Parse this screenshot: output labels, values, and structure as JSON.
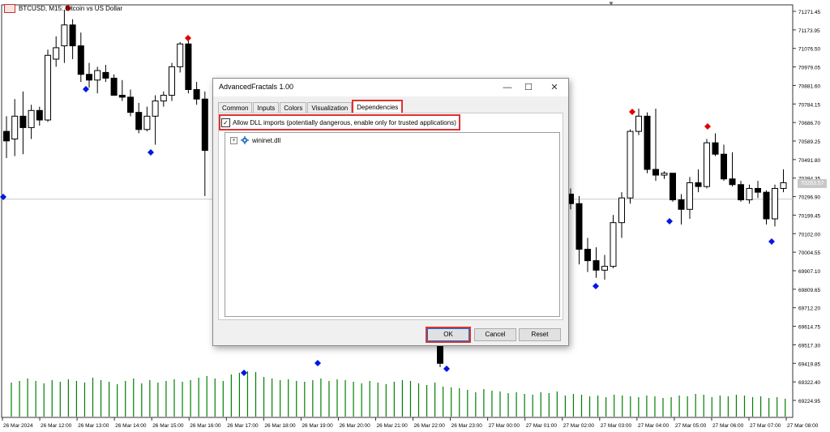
{
  "chart": {
    "title": "BTCUSD, M15: Bitcoin vs US Dollar",
    "current_price": "70283.57",
    "price_levels": [
      "71271.45",
      "71173.95",
      "71076.50",
      "70979.05",
      "70881.60",
      "70784.15",
      "70686.70",
      "70589.25",
      "70491.80",
      "70394.35",
      "70296.90",
      "70199.45",
      "70102.00",
      "70004.55",
      "69907.10",
      "69809.65",
      "69712.20",
      "69614.75",
      "69517.30",
      "69419.85",
      "69322.40",
      "69224.95"
    ],
    "time_labels": [
      "26 Mar 2024",
      "26 Mar 12:00",
      "26 Mar 13:00",
      "26 Mar 14:00",
      "26 Mar 15:00",
      "26 Mar 16:00",
      "26 Mar 17:00",
      "26 Mar 18:00",
      "26 Mar 19:00",
      "26 Mar 20:00",
      "26 Mar 21:00",
      "26 Mar 22:00",
      "26 Mar 23:00",
      "27 Mar 00:00",
      "27 Mar 01:00",
      "27 Mar 02:00",
      "27 Mar 03:00",
      "27 Mar 04:00",
      "27 Mar 05:00",
      "27 Mar 06:00",
      "27 Mar 07:00",
      "27 Mar 08:00"
    ],
    "colors": {
      "bull_candle": "#ffffff",
      "bear_candle": "#000000",
      "volume": "#008000",
      "fractal_up": "#e00000",
      "fractal_down": "#0018e0",
      "grid": "#c8c8c8"
    },
    "candles_left": [
      [
        70640,
        70720,
        70500,
        70590
      ],
      [
        70600,
        70810,
        70510,
        70720
      ],
      [
        70720,
        70850,
        70520,
        70660
      ],
      [
        70660,
        70780,
        70600,
        70750
      ],
      [
        70750,
        70770,
        70670,
        70700
      ],
      [
        70700,
        71070,
        70690,
        71040
      ],
      [
        71020,
        71140,
        70980,
        71080
      ],
      [
        71090,
        71280,
        71000,
        71200
      ],
      [
        71200,
        71230,
        71020,
        71090
      ],
      [
        71090,
        71160,
        70900,
        70940
      ],
      [
        70940,
        71000,
        70870,
        70910
      ],
      [
        70910,
        70980,
        70840,
        70960
      ],
      [
        70950,
        70990,
        70900,
        70920
      ],
      [
        70920,
        70940,
        70830,
        70830
      ],
      [
        70830,
        70910,
        70800,
        70820
      ],
      [
        70820,
        70860,
        70720,
        70740
      ],
      [
        70740,
        70790,
        70630,
        70650
      ],
      [
        70650,
        70770,
        70640,
        70720
      ],
      [
        70720,
        70830,
        70570,
        70800
      ],
      [
        70800,
        70850,
        70770,
        70830
      ],
      [
        70830,
        71000,
        70800,
        70980
      ],
      [
        70980,
        71110,
        70950,
        71100
      ],
      [
        71100,
        71140,
        70840,
        70860
      ],
      [
        70860,
        70900,
        70780,
        70810
      ],
      [
        70810,
        70850,
        70300,
        70540
      ]
    ],
    "candles_right": [
      [
        70310,
        70340,
        70230,
        70260
      ],
      [
        70260,
        70300,
        69940,
        70020
      ],
      [
        70020,
        70080,
        69900,
        69960
      ],
      [
        69960,
        70030,
        69870,
        69910
      ],
      [
        69910,
        69990,
        69860,
        69930
      ],
      [
        69930,
        70200,
        69920,
        70160
      ],
      [
        70160,
        70320,
        70080,
        70290
      ],
      [
        70290,
        70650,
        70260,
        70640
      ],
      [
        70640,
        70760,
        70620,
        70720
      ],
      [
        70720,
        70740,
        70420,
        70440
      ],
      [
        70440,
        70760,
        70380,
        70410
      ],
      [
        70410,
        70430,
        70390,
        70420
      ],
      [
        70420,
        70420,
        70270,
        70280
      ],
      [
        70280,
        70310,
        70150,
        70230
      ],
      [
        70230,
        70400,
        70180,
        70370
      ],
      [
        70370,
        70440,
        70320,
        70350
      ],
      [
        70350,
        70600,
        70340,
        70580
      ],
      [
        70580,
        70630,
        70510,
        70520
      ],
      [
        70520,
        70570,
        70380,
        70390
      ],
      [
        70390,
        70530,
        70350,
        70360
      ],
      [
        70360,
        70380,
        70270,
        70280
      ],
      [
        70280,
        70360,
        70260,
        70340
      ],
      [
        70340,
        70380,
        70290,
        70320
      ],
      [
        70320,
        70330,
        70150,
        70180
      ],
      [
        70180,
        70360,
        70140,
        70340
      ],
      [
        70340,
        70440,
        70320,
        70370
      ]
    ],
    "candles_hidden_visible": [
      [
        69560,
        69580,
        69520,
        69540
      ],
      [
        69540,
        69560,
        69400,
        69420
      ]
    ],
    "volumes": [
      42,
      44,
      47,
      44,
      41,
      45,
      43,
      46,
      44,
      42,
      48,
      45,
      43,
      40,
      44,
      47,
      41,
      45,
      42,
      44,
      46,
      43,
      45,
      48,
      50,
      47,
      44,
      52,
      54,
      56,
      55,
      49,
      47,
      45,
      46,
      44,
      43,
      45,
      47,
      44,
      46,
      45,
      43,
      41,
      44,
      42,
      40,
      43,
      45,
      44,
      41,
      39,
      42,
      37,
      36,
      35,
      33,
      30,
      34,
      32,
      31,
      29,
      30,
      28,
      27,
      30,
      29,
      31,
      26,
      28,
      27,
      25,
      26,
      24,
      27,
      26,
      25,
      24,
      26,
      25,
      23,
      24,
      26,
      25,
      28,
      27,
      24,
      26,
      25,
      27,
      26,
      24,
      25,
      23,
      24,
      22
    ]
  },
  "dialog": {
    "title": "AdvancedFractals 1.00",
    "tabs": [
      "Common",
      "Inputs",
      "Colors",
      "Visualization",
      "Dependencies"
    ],
    "active_tab": "Dependencies",
    "allow_dll_label": "Allow DLL imports (potentially dangerous, enable only for trusted applications)",
    "allow_dll_checked": true,
    "dependency_item": "wininet.dll",
    "buttons": {
      "ok": "OK",
      "cancel": "Cancel",
      "reset": "Reset"
    },
    "window_controls": {
      "minimize": "—",
      "maximize": "☐",
      "close": "✕"
    }
  }
}
